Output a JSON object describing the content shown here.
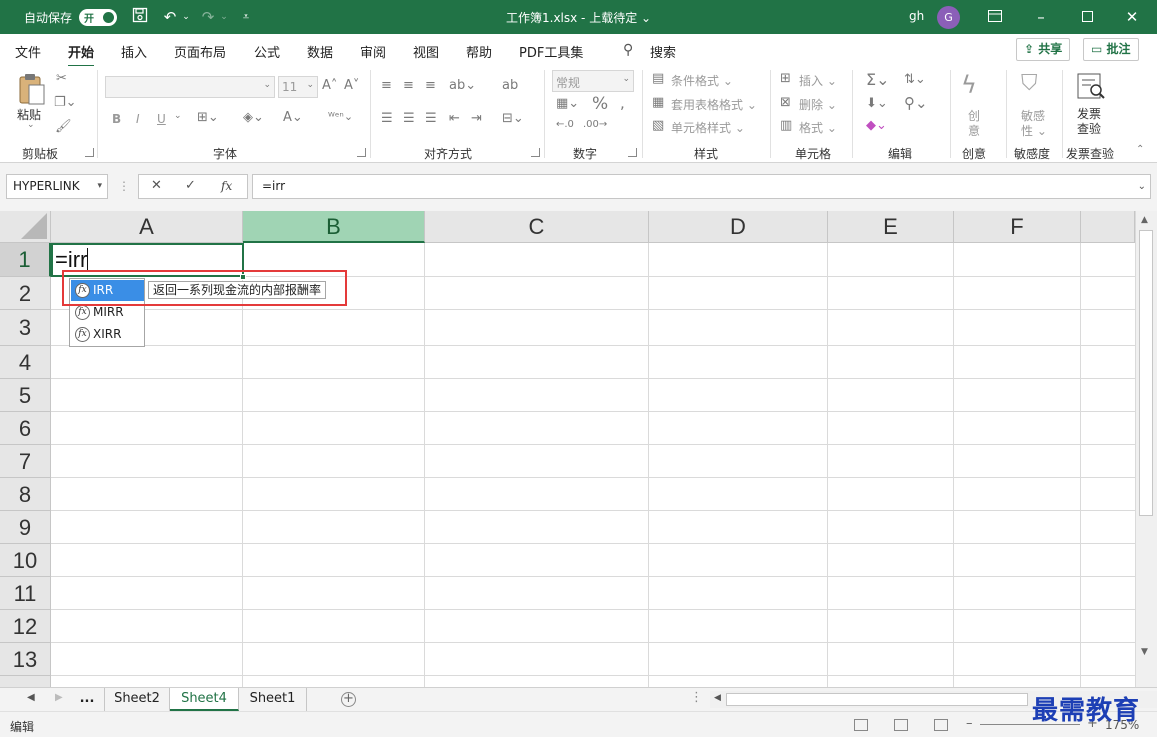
{
  "titlebar": {
    "autosave_label": "自动保存",
    "autosave_state": "开",
    "doc_title": "工作簿1.xlsx - 上载待定 ⌄",
    "user": "gh",
    "avatar_letter": "G"
  },
  "menu": {
    "tabs": [
      "文件",
      "开始",
      "插入",
      "页面布局",
      "公式",
      "数据",
      "审阅",
      "视图",
      "帮助",
      "PDF工具集"
    ],
    "active": "开始",
    "search": "搜索",
    "share": "共享",
    "comment": "批注"
  },
  "ribbon": {
    "clipboard": {
      "paste": "粘贴",
      "label": "剪贴板"
    },
    "font": {
      "size": "11",
      "bold": "B",
      "italic": "I",
      "underline": "U",
      "label": "字体"
    },
    "alignment": {
      "label": "对齐方式"
    },
    "number": {
      "format": "常规",
      "label": "数字"
    },
    "styles": {
      "conditional": "条件格式 ⌄",
      "table": "套用表格格式 ⌄",
      "cell": "单元格样式 ⌄",
      "label": "样式"
    },
    "cells": {
      "insert": "插入 ⌄",
      "delete": "删除 ⌄",
      "format": "格式 ⌄",
      "label": "单元格"
    },
    "editing": {
      "label": "编辑"
    },
    "ideas": {
      "line1": "创",
      "line2": "意",
      "label": "创意"
    },
    "sensitivity": {
      "line1": "敏感",
      "line2": "性 ⌄",
      "label": "敏感度"
    },
    "invoice": {
      "line1": "发票",
      "line2": "查验",
      "label": "发票查验"
    }
  },
  "formulabar": {
    "namebox": "HYPERLINK",
    "formula": "=irr"
  },
  "grid": {
    "columns": [
      "A",
      "B",
      "C",
      "D",
      "E",
      "F"
    ],
    "rows": [
      "1",
      "2",
      "3",
      "4",
      "5",
      "6",
      "7",
      "8",
      "9",
      "10",
      "11",
      "12",
      "13"
    ],
    "active_cell_text": "=irr"
  },
  "autocomplete": {
    "items": [
      "IRR",
      "MIRR",
      "XIRR"
    ],
    "selected": "IRR",
    "tooltip": "返回一系列现金流的内部报酬率"
  },
  "sheets": {
    "ellipsis": "...",
    "tabs": [
      "Sheet2",
      "Sheet4",
      "Sheet1"
    ],
    "active": "Sheet4"
  },
  "status": {
    "mode": "编辑",
    "zoom": "175%"
  },
  "watermark": "最需教育",
  "colors": {
    "excel_green": "#217346",
    "highlight_red": "#e43a3a",
    "selection_blue": "#3a8ee6"
  }
}
